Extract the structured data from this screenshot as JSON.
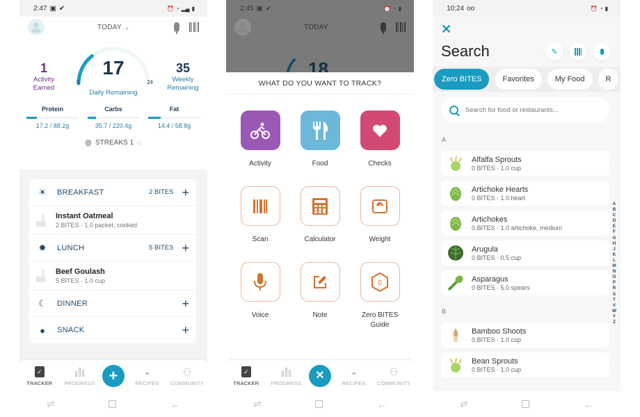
{
  "panel1": {
    "status": {
      "time": "2:47",
      "icons_left": [
        "image-icon",
        "check-icon"
      ],
      "icons_right": [
        "alarm-icon",
        "wifi-icon",
        "signal-icon",
        "battery-icon"
      ]
    },
    "header": {
      "date_selector": "TODAY"
    },
    "activity": {
      "value": "1",
      "label_line1": "Activity",
      "label_line2": "Earned"
    },
    "daily": {
      "value": "17",
      "min": "0",
      "max": "24",
      "label": "Daily Remaining",
      "fraction_used": 0.29
    },
    "weekly": {
      "value": "35",
      "label_line1": "Weekly",
      "label_line2": "Remaining"
    },
    "macros": [
      {
        "name": "Protein",
        "value": "17.2 / 88.2g",
        "progress": 0.195
      },
      {
        "name": "Carbs",
        "value": "35.7 / 220.4g",
        "progress": 0.162
      },
      {
        "name": "Fat",
        "value": "14.4 / 58.8g",
        "progress": 0.245
      }
    ],
    "streaks": "STREAKS 1",
    "meals": [
      {
        "name": "BREAKFAST",
        "bites": "2 BITES",
        "icon": "sunrise-icon",
        "foods": [
          {
            "name": "Instant Oatmeal",
            "detail": "2 BITES · 1.0 packet, cooked"
          }
        ]
      },
      {
        "name": "LUNCH",
        "bites": "5 BITES",
        "icon": "sun-icon",
        "foods": [
          {
            "name": "Beef Goulash",
            "detail": "5 BITES · 1.0 cup"
          }
        ]
      },
      {
        "name": "DINNER",
        "bites": "",
        "icon": "moon-icon",
        "foods": []
      },
      {
        "name": "SNACK",
        "bites": "",
        "icon": "apple-icon",
        "foods": []
      }
    ]
  },
  "tabbar": {
    "tabs": [
      {
        "label": "TRACKER",
        "icon": "clipboard-icon",
        "active": true
      },
      {
        "label": "PROGRESS",
        "icon": "bar-chart-icon"
      },
      {
        "label": "RECIPES",
        "icon": "bowl-icon"
      },
      {
        "label": "COMMUNITY",
        "icon": "people-icon"
      }
    ]
  },
  "panel2": {
    "status": {
      "time": "2:45"
    },
    "header": {
      "date_selector": "TODAY"
    },
    "dim_value": "18",
    "sheet_title": "WHAT DO YOU WANT TO TRACK?",
    "options": [
      {
        "label": "Activity",
        "icon": "bike-icon",
        "color": "#9b59b6"
      },
      {
        "label": "Food",
        "icon": "utensils-icon",
        "color": "#6cb8db"
      },
      {
        "label": "Checks",
        "icon": "heart-icon",
        "color": "#d24a73"
      },
      {
        "label": "Scan",
        "icon": "barcode-icon"
      },
      {
        "label": "Calculator",
        "icon": "calculator-icon"
      },
      {
        "label": "Weight",
        "icon": "scale-icon"
      },
      {
        "label": "Voice",
        "icon": "microphone-icon"
      },
      {
        "label": "Note",
        "icon": "note-edit-icon"
      },
      {
        "label": "Zero BITES Guide",
        "icon": "zero-hexagon-icon"
      }
    ]
  },
  "panel3": {
    "status": {
      "time": "10:24"
    },
    "title": "Search",
    "chips": [
      "Zero BITES",
      "Favorites",
      "My Food",
      "R"
    ],
    "search_placeholder": "Search for food or restaurants...",
    "sections": [
      {
        "letter": "A",
        "items": [
          {
            "name": "Alfalfa Sprouts",
            "detail": "0 BITES · 1.0 cup"
          },
          {
            "name": "Artichoke Hearts",
            "detail": "0 BITES · 1.0 heart"
          },
          {
            "name": "Artichokes",
            "detail": "0 BITES · 1.0 artichoke, medium"
          },
          {
            "name": "Arugula",
            "detail": "0 BITES · 0.5 cup"
          },
          {
            "name": "Asparagus",
            "detail": "0 BITES · 5.0 spears"
          }
        ]
      },
      {
        "letter": "B",
        "items": [
          {
            "name": "Bamboo Shoots",
            "detail": "0 BITES · 1.0 cup"
          },
          {
            "name": "Bean Sprouts",
            "detail": "0 BITES · 1.0 cup"
          }
        ]
      }
    ],
    "alphabet": [
      "A",
      "B",
      "C",
      "D",
      "E",
      "F",
      "G",
      "H",
      "J",
      "K",
      "L",
      "M",
      "N",
      "O",
      "P",
      "R",
      "S",
      "T",
      "V",
      "W",
      "Y",
      "Z"
    ]
  },
  "colors": {
    "accent": "#1a9bbf",
    "navy": "#1d3b55",
    "activity_purple": "#6b2f86",
    "tile_outline": "#d2732f"
  }
}
